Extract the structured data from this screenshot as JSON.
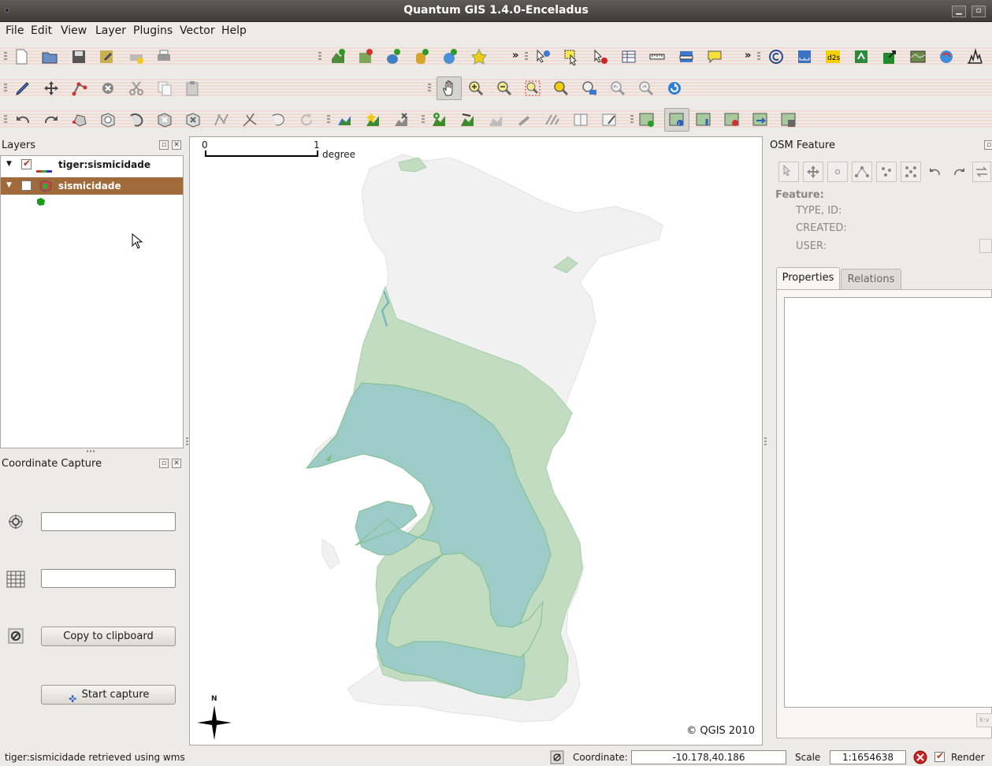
{
  "window": {
    "title": "Quantum GIS 1.4.0-Enceladus"
  },
  "menu": [
    "File",
    "Edit",
    "View",
    "Layer",
    "Plugins",
    "Vector",
    "Help"
  ],
  "layers_panel": {
    "title": "Layers",
    "layers": [
      {
        "name": "tiger:sismicidade",
        "checked": true
      },
      {
        "name": "sismicidade",
        "checked": false,
        "selected": true
      }
    ]
  },
  "coordinate_capture": {
    "title": "Coordinate Capture",
    "copy_label": "Copy to clipboard",
    "start_label": "Start capture"
  },
  "map": {
    "scalebar_start": "0",
    "scalebar_end": "1",
    "scalebar_unit": "degree",
    "north_label": "N",
    "copyright": "© QGIS 2010",
    "colors": {
      "outer": "#f0f0f0",
      "light_zone": "#c2dcc2",
      "teal_zone": "#9ccbc8",
      "edge": "#7fbf8a"
    }
  },
  "osm_panel": {
    "title": "OSM Feature",
    "feature_label": "Feature:",
    "type_id_label": "TYPE, ID:",
    "created_label": "CREATED:",
    "user_label": "USER:",
    "tabs": [
      "Properties",
      "Relations"
    ],
    "kv_label": "k:v"
  },
  "status": {
    "message": "tiger:sismicidade retrieved using wms",
    "coordinate_label": "Coordinate:",
    "coordinate_value": "-10.178,40.186",
    "scale_label": "Scale",
    "scale_value": "1:1654638",
    "render_label": "Render"
  }
}
